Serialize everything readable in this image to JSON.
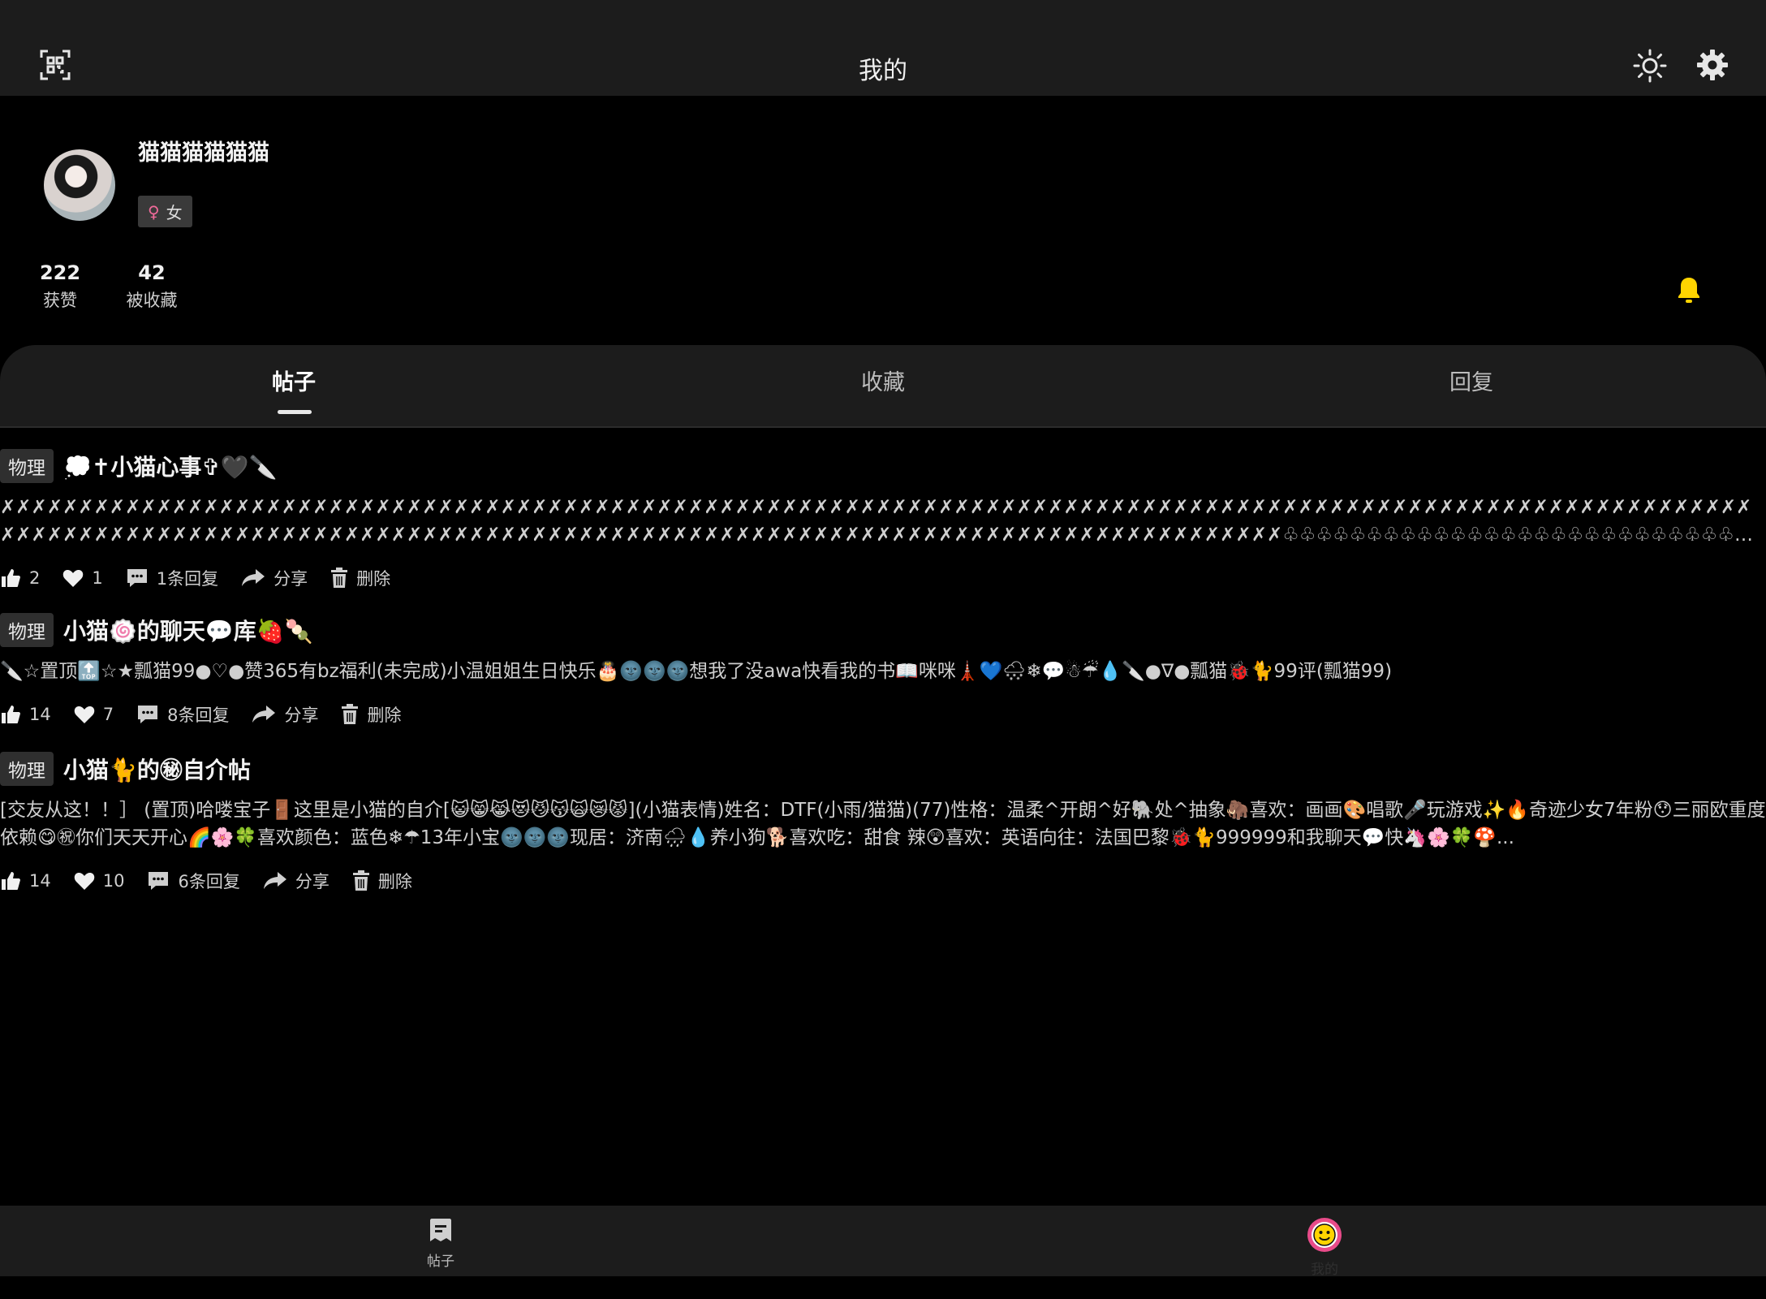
{
  "header": {
    "title": "我的",
    "icons": {
      "left": "qr-scan-icon",
      "right": [
        "sun-icon",
        "gear-icon"
      ]
    }
  },
  "profile": {
    "username": "猫猫猫猫猫猫",
    "gender_label": "女",
    "gender_icon": "female-icon",
    "stats": [
      {
        "value": "222",
        "label": "获赞"
      },
      {
        "value": "42",
        "label": "被收藏"
      }
    ]
  },
  "tabs": [
    {
      "label": "帖子",
      "active": true
    },
    {
      "label": "收藏",
      "active": false
    },
    {
      "label": "回复",
      "active": false
    }
  ],
  "posts": [
    {
      "category": "物理",
      "title": "💭✝小猫心事✞🖤🔪",
      "body": "✗✗✗✗✗✗✗✗✗✗✗✗✗✗✗✗✗✗✗✗✗✗✗✗✗✗✗✗✗✗✗✗✗✗✗✗✗✗✗✗✗✗✗✗✗✗✗✗✗✗✗✗✗✗✗✗✗✗✗✗✗✗✗✗✗✗✗✗✗✗✗✗✗✗✗✗✗✗✗✗✗✗✗✗✗✗✗✗✗✗✗✗✗✗✗✗✗✗✗✗✗✗✗✗✗✗✗✗✗✗✗✗✗✗✗✗✗✗✗✗✗✗✗✗✗✗✗✗✗✗✗✗✗✗✗✗✗✗✗✗✗✗✗✗✗✗✗✗✗✗✗✗✗✗✗✗✗✗✗✗✗✗✗✗✗✗✗✗✗✗✗✗✗✗✗✗✗✗✗✗✗✗✗✗✗✗✗✗✗✗✗✗✗✗♧♧♧♧♧♧♧♧♧♧♧♧♧♧♧♧♧♧♧♧♧♧♧♧♧♧♧♧♧♧♧♧♧♧♧♧♧♧♧♧♧♧☆☆☆☆☆☆☆☆☆☆☆☆☆☆☆☆☆☆☆☆☆☆☆☆☆☆☆☆☆☆☆☆☆☆☆☆☆☆☆☆☆☆☆☆☆☆☆☆☆☆☆☆☆☆☆☆☆☆☆☆...",
      "likes": "2",
      "favorites": "1",
      "replies": "1条回复",
      "share": "分享",
      "delete": "删除"
    },
    {
      "category": "物理",
      "title": "小猫🍥的聊天💬库🍓🍡",
      "body": "🔪☆置顶🔝☆★瓢猫99●♡●赞365有bz福利(未完成)小温姐姐生日快乐🎂🌚🌚🌚想我了没awa快看我的书📖咪咪🗼💙🌨❄💬☃☔💧🔪●∇●瓢猫🐞🐈99评(瓢猫99)",
      "likes": "14",
      "favorites": "7",
      "replies": "8条回复",
      "share": "分享",
      "delete": "删除"
    },
    {
      "category": "物理",
      "title": "小猫🐈的㊙自介帖",
      "body": "  [交友从这！！］ (置顶)哈喽宝子🚪这里是小猫的自介[😺😸😹😻😼😽🙀😿😾](小猫表情)姓名：DTF(小雨/猫猫)(77)性格：温柔^开朗^好🐘处^抽象🦣喜欢：画画🎨唱歌🎤玩游戏✨🔥奇迹少女7年粉😯三丽欧重度依赖😋㊗你们天天开心🌈🌸🍀喜欢颜色：蓝色❄☂13年小宝🌚🌚🌚现居：济南🌧💧养小狗🐕喜欢吃：甜食 辣😲喜欢：英语向往：法国巴黎🐞🐈999999和我聊天💬快🦄🌸🍀🍄...",
      "likes": "14",
      "favorites": "10",
      "replies": "6条回复",
      "share": "分享",
      "delete": "删除"
    }
  ],
  "bottom_nav": [
    {
      "label": "帖子",
      "icon": "posts-icon"
    },
    {
      "label": "我的",
      "icon": "smiley-avatar-icon"
    }
  ],
  "colors": {
    "background": "#000000",
    "bar": "#1c1c1c",
    "tag_bg": "#2f2f2f",
    "bell": "#ffd400",
    "female": "#f06a9a",
    "avatar_ring": "#e94b8a"
  }
}
